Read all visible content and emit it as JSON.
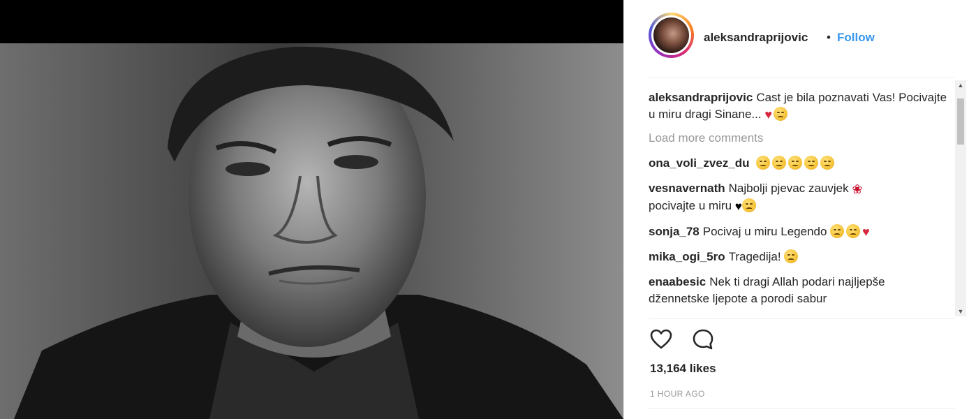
{
  "post": {
    "username": "aleksandraprijovic",
    "dot": "•",
    "follow_label": "Follow",
    "likes": "13,164 likes",
    "time": "1 HOUR AGO"
  },
  "caption": {
    "user": "aleksandraprijovic",
    "text": "Cast je bila poznavati Vas! Pocivajte u miru dragi Sinane..."
  },
  "load_more": "Load more comments",
  "comments": [
    {
      "user": "ona_voli_zvez_du",
      "text": ""
    },
    {
      "user": "vesnavernath",
      "text": "Najbolji pjevac zauvjek",
      "text2": "pocivajte u miru"
    },
    {
      "user": "sonja_78",
      "text": "Pocivaj u miru Legendo"
    },
    {
      "user": "mika_ogi_5ro",
      "text": "Tragedija!"
    },
    {
      "user": "enaabesic",
      "text": "Nek ti dragi Allah podari najljepše džennetske ljepote a porodi sabur"
    }
  ],
  "colors": {
    "follow": "#3897f0",
    "muted": "#999999",
    "text": "#262626"
  },
  "icons": {
    "like": "heart-outline-icon",
    "comment": "speech-bubble-icon"
  }
}
